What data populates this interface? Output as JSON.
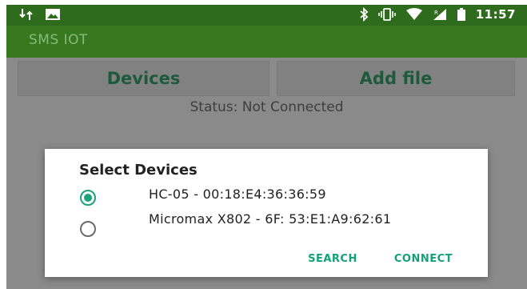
{
  "status_bar": {
    "time": "11:57",
    "icons_left": [
      "data-transfer-icon",
      "image-icon"
    ],
    "icons_right": [
      "bluetooth-icon",
      "vibrate-icon",
      "wifi-icon",
      "signal-icon",
      "battery-icon"
    ]
  },
  "app_bar": {
    "title": "SMS IOT"
  },
  "tabs": [
    {
      "label": "Devices"
    },
    {
      "label": "Add file"
    }
  ],
  "status": {
    "text": "Status: Not Connected"
  },
  "dialog": {
    "title": "Select Devices",
    "options": [
      {
        "label": "HC-05 - 00:18:E4:36:36:59",
        "selected": true
      },
      {
        "label": "Micromax X802 - 6F: 53:E1:A9:62:61",
        "selected": false
      }
    ],
    "actions": {
      "search": "SEARCH",
      "connect": "CONNECT"
    }
  },
  "colors": {
    "status_bar": "#2e6b1c",
    "app_bar": "#38791f",
    "accent": "#1aa37a",
    "scrim": "#8a8a8a"
  }
}
